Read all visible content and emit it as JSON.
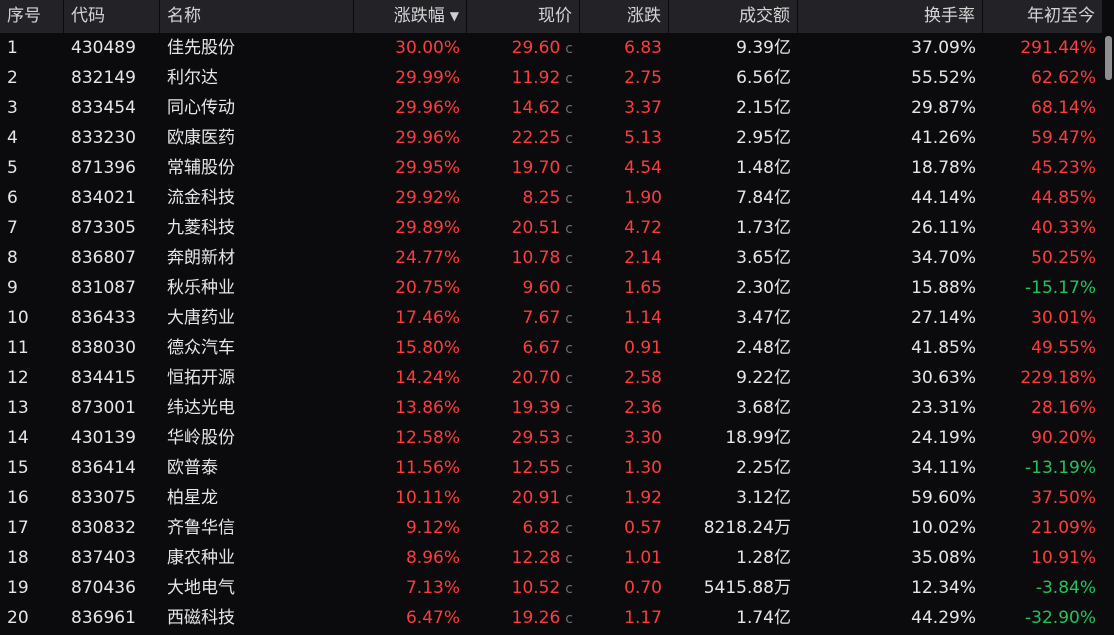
{
  "columns": {
    "idx": "序号",
    "code": "代码",
    "name": "名称",
    "pct": "涨跌幅",
    "price": "现价",
    "chg": "涨跌",
    "vol": "成交额",
    "turn": "换手率",
    "ytd": "年初至今"
  },
  "sort_icon": "caret-down-icon",
  "price_flag": "c",
  "colors": {
    "up": "#ff3b3b",
    "down": "#22c35b",
    "header_bg": "#232327",
    "bg": "#0b0b0e"
  },
  "rows": [
    {
      "idx": "1",
      "code": "430489",
      "name": "佳先股份",
      "pct": "30.00%",
      "price": "29.60",
      "chg": "6.83",
      "vol": "9.39亿",
      "turn": "37.09%",
      "ytd": "291.44%"
    },
    {
      "idx": "2",
      "code": "832149",
      "name": "利尔达",
      "pct": "29.99%",
      "price": "11.92",
      "chg": "2.75",
      "vol": "6.56亿",
      "turn": "55.52%",
      "ytd": "62.62%"
    },
    {
      "idx": "3",
      "code": "833454",
      "name": "同心传动",
      "pct": "29.96%",
      "price": "14.62",
      "chg": "3.37",
      "vol": "2.15亿",
      "turn": "29.87%",
      "ytd": "68.14%"
    },
    {
      "idx": "4",
      "code": "833230",
      "name": "欧康医药",
      "pct": "29.96%",
      "price": "22.25",
      "chg": "5.13",
      "vol": "2.95亿",
      "turn": "41.26%",
      "ytd": "59.47%"
    },
    {
      "idx": "5",
      "code": "871396",
      "name": "常辅股份",
      "pct": "29.95%",
      "price": "19.70",
      "chg": "4.54",
      "vol": "1.48亿",
      "turn": "18.78%",
      "ytd": "45.23%"
    },
    {
      "idx": "6",
      "code": "834021",
      "name": "流金科技",
      "pct": "29.92%",
      "price": "8.25",
      "chg": "1.90",
      "vol": "7.84亿",
      "turn": "44.14%",
      "ytd": "44.85%"
    },
    {
      "idx": "7",
      "code": "873305",
      "name": "九菱科技",
      "pct": "29.89%",
      "price": "20.51",
      "chg": "4.72",
      "vol": "1.73亿",
      "turn": "26.11%",
      "ytd": "40.33%"
    },
    {
      "idx": "8",
      "code": "836807",
      "name": "奔朗新材",
      "pct": "24.77%",
      "price": "10.78",
      "chg": "2.14",
      "vol": "3.65亿",
      "turn": "34.70%",
      "ytd": "50.25%"
    },
    {
      "idx": "9",
      "code": "831087",
      "name": "秋乐种业",
      "pct": "20.75%",
      "price": "9.60",
      "chg": "1.65",
      "vol": "2.30亿",
      "turn": "15.88%",
      "ytd": "-15.17%"
    },
    {
      "idx": "10",
      "code": "836433",
      "name": "大唐药业",
      "pct": "17.46%",
      "price": "7.67",
      "chg": "1.14",
      "vol": "3.47亿",
      "turn": "27.14%",
      "ytd": "30.01%"
    },
    {
      "idx": "11",
      "code": "838030",
      "name": "德众汽车",
      "pct": "15.80%",
      "price": "6.67",
      "chg": "0.91",
      "vol": "2.48亿",
      "turn": "41.85%",
      "ytd": "49.55%"
    },
    {
      "idx": "12",
      "code": "834415",
      "name": "恒拓开源",
      "pct": "14.24%",
      "price": "20.70",
      "chg": "2.58",
      "vol": "9.22亿",
      "turn": "30.63%",
      "ytd": "229.18%"
    },
    {
      "idx": "13",
      "code": "873001",
      "name": "纬达光电",
      "pct": "13.86%",
      "price": "19.39",
      "chg": "2.36",
      "vol": "3.68亿",
      "turn": "23.31%",
      "ytd": "28.16%"
    },
    {
      "idx": "14",
      "code": "430139",
      "name": "华岭股份",
      "pct": "12.58%",
      "price": "29.53",
      "chg": "3.30",
      "vol": "18.99亿",
      "turn": "24.19%",
      "ytd": "90.20%"
    },
    {
      "idx": "15",
      "code": "836414",
      "name": "欧普泰",
      "pct": "11.56%",
      "price": "12.55",
      "chg": "1.30",
      "vol": "2.25亿",
      "turn": "34.11%",
      "ytd": "-13.19%"
    },
    {
      "idx": "16",
      "code": "833075",
      "name": "柏星龙",
      "pct": "10.11%",
      "price": "20.91",
      "chg": "1.92",
      "vol": "3.12亿",
      "turn": "59.60%",
      "ytd": "37.50%"
    },
    {
      "idx": "17",
      "code": "830832",
      "name": "齐鲁华信",
      "pct": "9.12%",
      "price": "6.82",
      "chg": "0.57",
      "vol": "8218.24万",
      "turn": "10.02%",
      "ytd": "21.09%"
    },
    {
      "idx": "18",
      "code": "837403",
      "name": "康农种业",
      "pct": "8.96%",
      "price": "12.28",
      "chg": "1.01",
      "vol": "1.28亿",
      "turn": "35.08%",
      "ytd": "10.91%"
    },
    {
      "idx": "19",
      "code": "870436",
      "name": "大地电气",
      "pct": "7.13%",
      "price": "10.52",
      "chg": "0.70",
      "vol": "5415.88万",
      "turn": "12.34%",
      "ytd": "-3.84%"
    },
    {
      "idx": "20",
      "code": "836961",
      "name": "西磁科技",
      "pct": "6.47%",
      "price": "19.26",
      "chg": "1.17",
      "vol": "1.74亿",
      "turn": "44.29%",
      "ytd": "-32.90%"
    }
  ]
}
